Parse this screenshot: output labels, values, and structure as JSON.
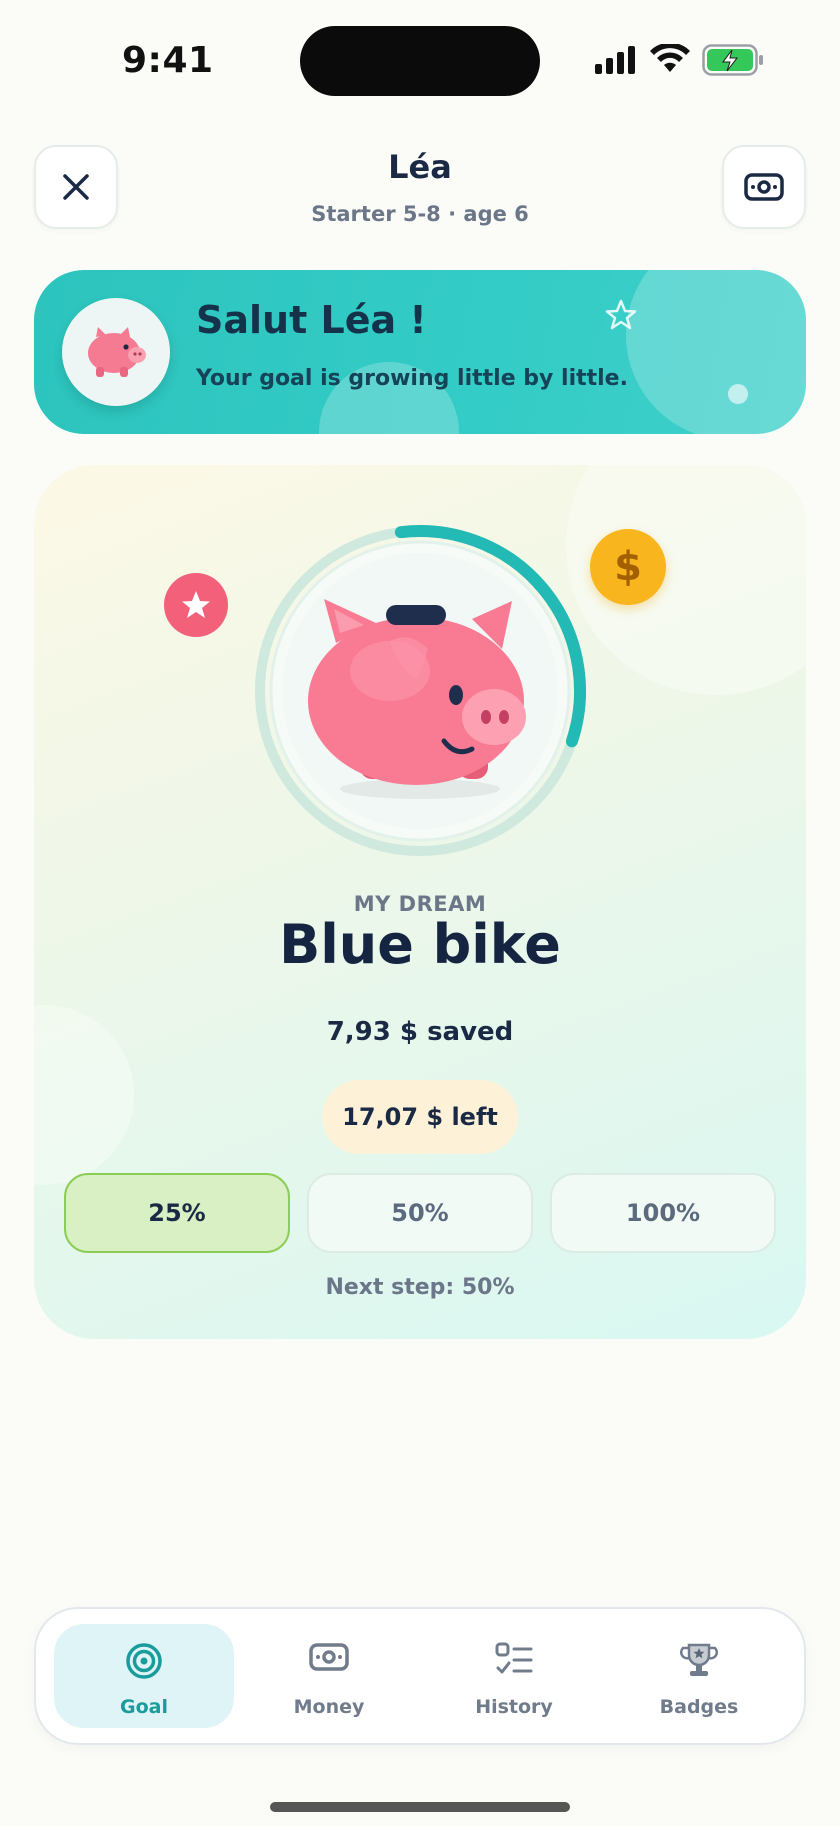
{
  "status_bar": {
    "time": "9:41"
  },
  "header": {
    "title": "Léa",
    "subtitle": "Starter 5-8 · age 6",
    "close_icon": "close-icon",
    "money_icon": "banknote-icon"
  },
  "banner": {
    "title": "Salut Léa !",
    "subtitle": "Your goal is growing little by little.",
    "avatar_icon": "piggy-bank-icon",
    "accent_color": "#2cc4bd"
  },
  "goal": {
    "dream_label": "MY DREAM",
    "dream_title": "Blue bike",
    "saved_text": "7,93 $ saved",
    "left_text": "17,07 $ left",
    "progress_fraction": 0.32,
    "coin_symbol": "$",
    "steps": [
      {
        "label": "25%",
        "reached": true
      },
      {
        "label": "50%",
        "reached": false
      },
      {
        "label": "100%",
        "reached": false
      }
    ],
    "next_step": "Next step: 50%"
  },
  "nav": {
    "items": [
      {
        "label": "Goal",
        "icon": "target-icon",
        "active": true
      },
      {
        "label": "Money",
        "icon": "banknote-icon",
        "active": false
      },
      {
        "label": "History",
        "icon": "checklist-icon",
        "active": false
      },
      {
        "label": "Badges",
        "icon": "trophy-icon",
        "active": false
      }
    ]
  },
  "colors": {
    "teal": "#2cc4bd",
    "pink": "#f2607a",
    "gold": "#f8b51d",
    "step_green": "#8cce55",
    "navy": "#152441"
  }
}
